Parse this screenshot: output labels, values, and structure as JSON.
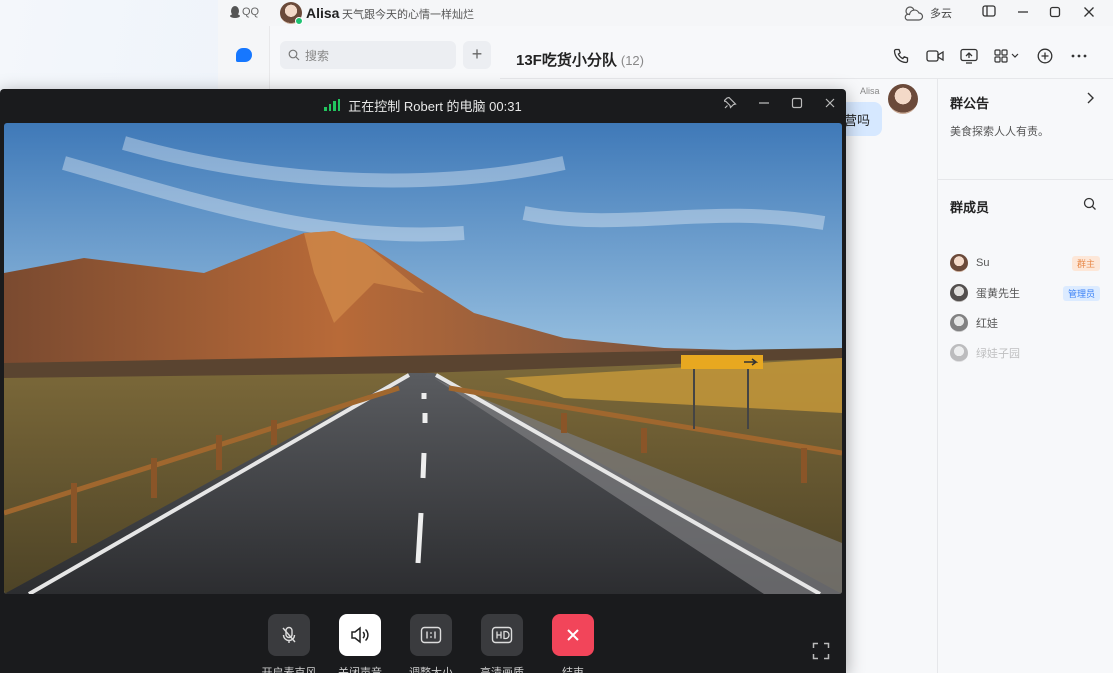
{
  "qq": {
    "logo": "QQ",
    "user_name": "Alisa",
    "signature": "天气跟今天的心情一样灿烂",
    "weather": "多云",
    "search_placeholder": "搜索",
    "group_name": "13F吃货小分队",
    "group_count": "(12)",
    "message": {
      "sender": "Alisa",
      "text": "营吗"
    },
    "notice": {
      "title": "群公告",
      "text": "美食探索人人有责。"
    },
    "members": {
      "title": "群成员",
      "list": [
        {
          "name": "Su",
          "role": "群主"
        },
        {
          "name": "蛋黄先生",
          "role": "管理员"
        },
        {
          "name": "红娃",
          "role": ""
        },
        {
          "name": "绿娃子园",
          "role": ""
        }
      ]
    }
  },
  "remote": {
    "title": "正在控制 Robert 的电脑 00:31",
    "controls": [
      {
        "label": "开启麦克风"
      },
      {
        "label": "关闭声音"
      },
      {
        "label": "调整大小"
      },
      {
        "label": "高清画质"
      },
      {
        "label": "结束"
      }
    ]
  },
  "colors": {
    "accent": "#1677ff",
    "end": "#f2455a",
    "signal": "#22c55e"
  }
}
